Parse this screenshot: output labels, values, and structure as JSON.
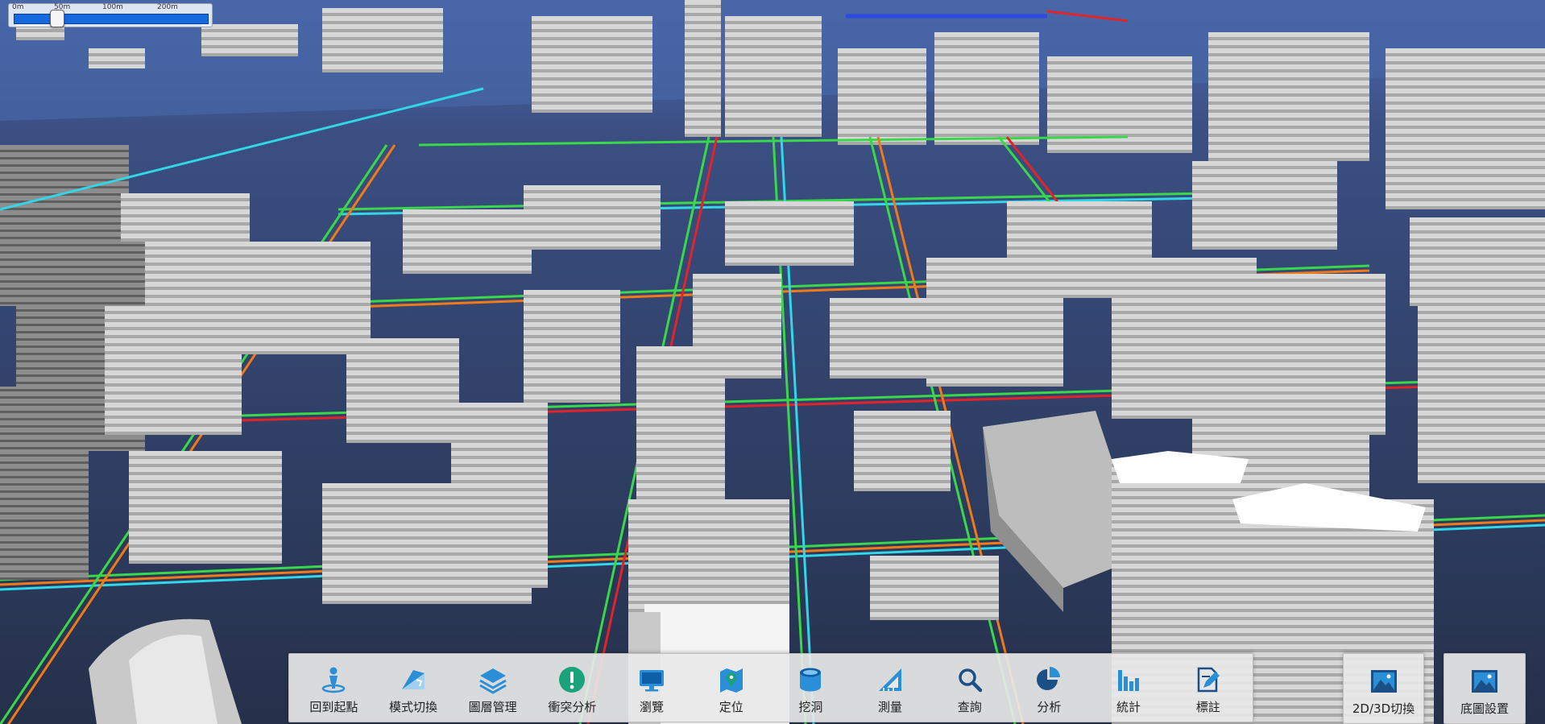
{
  "scale_bar": {
    "ticks": [
      "0m",
      "50m",
      "100m",
      "200m"
    ],
    "handle_fraction": 0.22
  },
  "toolbar": {
    "items": [
      {
        "label": "回到起點",
        "icon": "home-person-icon"
      },
      {
        "label": "模式切換",
        "icon": "mode-switch-icon"
      },
      {
        "label": "圖層管理",
        "icon": "layers-icon"
      },
      {
        "label": "衝突分析",
        "icon": "alert-icon"
      },
      {
        "label": "瀏覽",
        "icon": "monitor-icon"
      },
      {
        "label": "定位",
        "icon": "map-pin-icon"
      },
      {
        "label": "挖洞",
        "icon": "cylinder-icon"
      },
      {
        "label": "測量",
        "icon": "ruler-icon"
      },
      {
        "label": "查詢",
        "icon": "search-icon"
      },
      {
        "label": "分析",
        "icon": "pie-chart-icon"
      },
      {
        "label": "統計",
        "icon": "bar-chart-icon"
      },
      {
        "label": "標註",
        "icon": "annotate-icon"
      }
    ]
  },
  "mode_switch": {
    "label": "2D/3D切換",
    "icon": "landscape-image-icon"
  },
  "basemap": {
    "label": "底圖設置",
    "icon": "landscape-image-icon"
  },
  "colors": {
    "accent": "#2a8fd6",
    "alert": "#1aa37a",
    "ground": "#2a3550",
    "water": "#4a6aa8",
    "pipe_green": "#39d84a",
    "pipe_cyan": "#33d6e8",
    "pipe_orange": "#f07a1a",
    "pipe_red": "#e0242a",
    "pipe_blue": "#2b4be0"
  }
}
